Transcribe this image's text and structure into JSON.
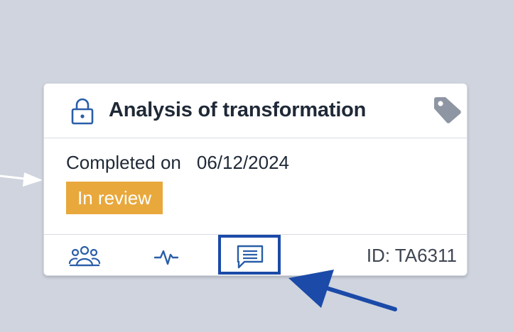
{
  "card": {
    "title": "Analysis of transformation",
    "completed_label": "Completed on",
    "completed_date": "06/12/2024",
    "status": "In review",
    "id_text": "ID: TA6311"
  },
  "icons": {
    "lock": "lock-icon",
    "tag": "tag-icon",
    "people": "people-icon",
    "activity": "activity-icon",
    "comment": "comment-icon"
  },
  "colors": {
    "background": "#cfd4de",
    "status_badge": "#e8a83c",
    "icon_blue": "#2a5ea8",
    "tag_gray": "#8e96a3",
    "highlight": "#1b4aa8"
  }
}
